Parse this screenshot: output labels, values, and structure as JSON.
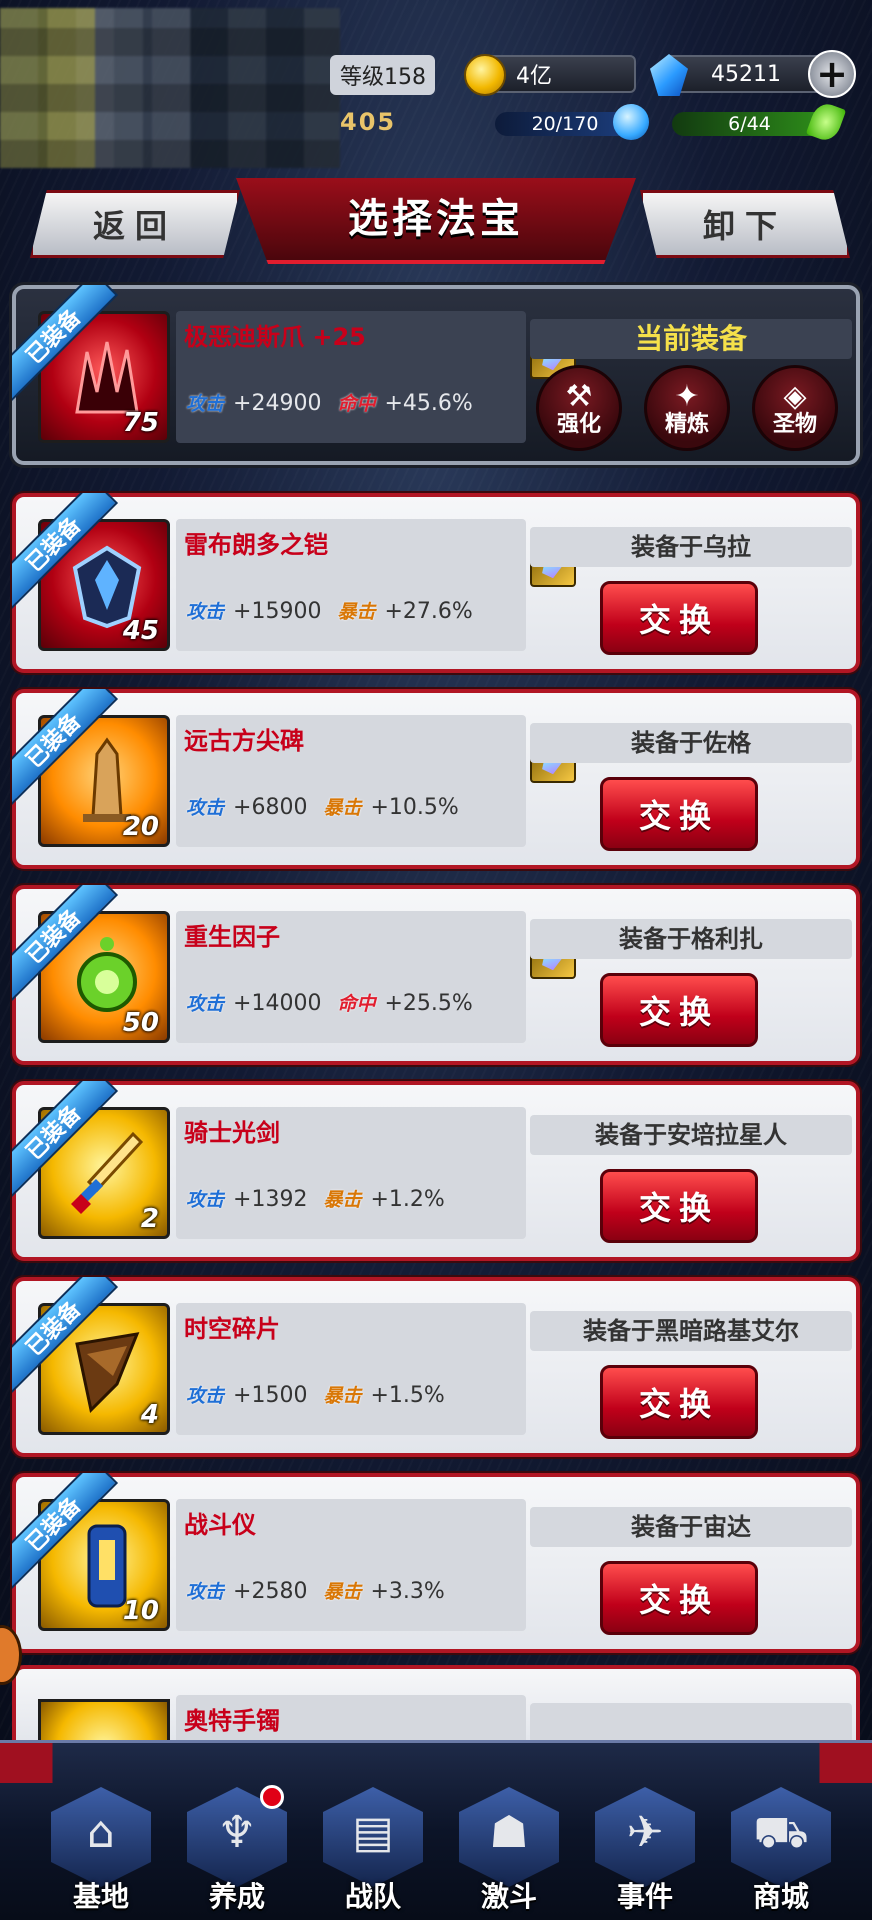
{
  "header": {
    "level": "等级158",
    "score": "405",
    "gold": "4亿",
    "diamond": "45211",
    "stamina": "20/170",
    "energy": "6/44",
    "title": "选择法宝",
    "back_label": "返回",
    "unequip_label": "卸下"
  },
  "current": {
    "ribbon": "已装备",
    "name": "极恶迪斯爪 +25",
    "level": "75",
    "atk_label": "攻击",
    "atk": "+24900",
    "stat2_label": "命中",
    "stat2": "+45.6%",
    "equip_label": "当前装备",
    "actions": [
      "强化",
      "精炼",
      "圣物"
    ]
  },
  "items": [
    {
      "ribbon": "已装备",
      "name": "雷布朗多之铠",
      "level": "45",
      "atk_label": "攻击",
      "atk": "+15900",
      "stat2_label": "暴击",
      "stat2": "+27.6%",
      "equipped_to": "装备于乌拉",
      "swap": "交换"
    },
    {
      "ribbon": "已装备",
      "name": "远古方尖碑",
      "level": "20",
      "atk_label": "攻击",
      "atk": "+6800",
      "stat2_label": "暴击",
      "stat2": "+10.5%",
      "equipped_to": "装备于佐格",
      "swap": "交换"
    },
    {
      "ribbon": "已装备",
      "name": "重生因子",
      "level": "50",
      "atk_label": "攻击",
      "atk": "+14000",
      "stat2_label": "命中",
      "stat2": "+25.5%",
      "equipped_to": "装备于格利扎",
      "swap": "交换"
    },
    {
      "ribbon": "已装备",
      "name": "骑士光剑",
      "level": "2",
      "atk_label": "攻击",
      "atk": "+1392",
      "stat2_label": "暴击",
      "stat2": "+1.2%",
      "equipped_to": "装备于安培拉星人",
      "swap": "交换"
    },
    {
      "ribbon": "已装备",
      "name": "时空碎片",
      "level": "4",
      "atk_label": "攻击",
      "atk": "+1500",
      "stat2_label": "暴击",
      "stat2": "+1.5%",
      "equipped_to": "装备于黑暗路基艾尔",
      "swap": "交换"
    },
    {
      "ribbon": "已装备",
      "name": "战斗仪",
      "level": "10",
      "atk_label": "攻击",
      "atk": "+2580",
      "stat2_label": "暴击",
      "stat2": "+3.3%",
      "equipped_to": "装备于宙达",
      "swap": "交换"
    }
  ],
  "partial_item": {
    "name": "奥特手镯"
  },
  "tabs": [
    "基地",
    "养成",
    "战队",
    "激斗",
    "事件",
    "商城"
  ],
  "colors": {
    "accent_red": "#b11624",
    "ribbon_blue": "#1f73c9",
    "equip_yellow": "#f5e04a"
  }
}
